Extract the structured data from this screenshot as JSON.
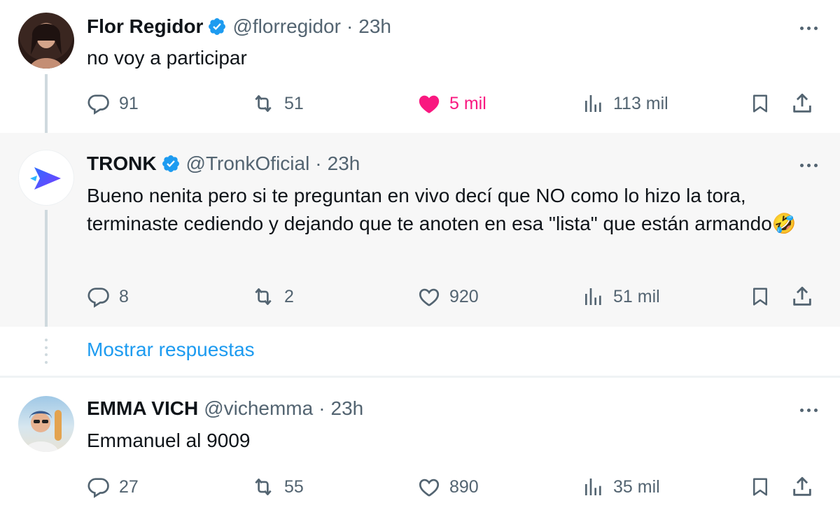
{
  "tweets": [
    {
      "name": "Flor Regidor",
      "verified": true,
      "handle": "@florregidor",
      "time": "23h",
      "text": "no voy a participar",
      "replies": "91",
      "retweets": "51",
      "likes": "5 mil",
      "liked": true,
      "views": "113 mil"
    },
    {
      "name": "TRONK",
      "verified": true,
      "handle": "@TronkOficial",
      "time": "23h",
      "text": "Bueno nenita pero si te preguntan en vivo decí que NO como lo hizo la tora, terminaste cediendo y dejando que te anoten en esa \"lista\" que están armando🤣",
      "replies": "8",
      "retweets": "2",
      "likes": "920",
      "liked": false,
      "views": "51 mil"
    },
    {
      "name": "EMMA VICH",
      "verified": false,
      "handle": "@vichemma",
      "time": "23h",
      "text": "Emmanuel al 9009",
      "replies": "27",
      "retweets": "55",
      "likes": "890",
      "liked": false,
      "views": "35 mil"
    }
  ],
  "show_replies_label": "Mostrar respuestas",
  "colors": {
    "accent": "#1d9bf0",
    "like": "#f91880",
    "muted": "#536471",
    "highlight_bg": "#f7f7f7"
  },
  "icons": [
    "verified-badge-icon",
    "more-icon",
    "reply-icon",
    "retweet-icon",
    "like-icon",
    "views-icon",
    "bookmark-icon",
    "share-icon"
  ]
}
